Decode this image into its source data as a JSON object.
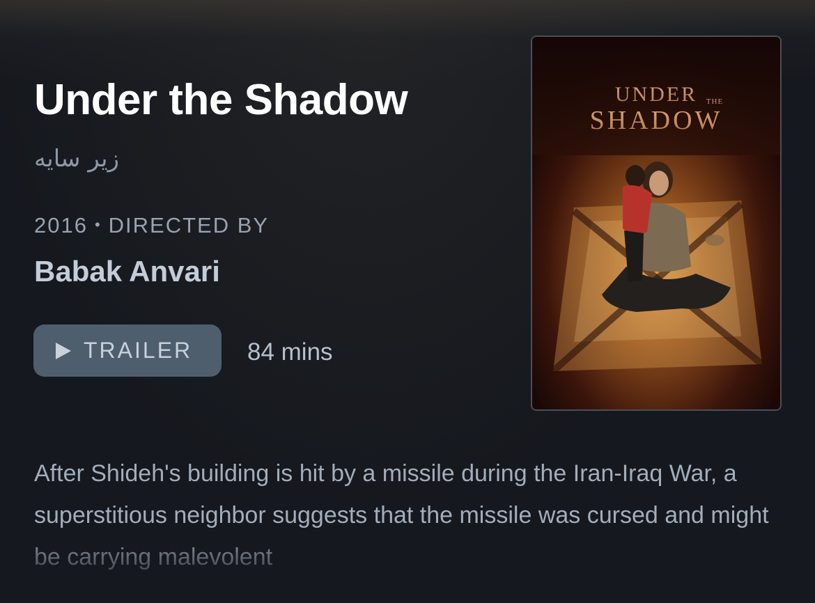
{
  "film": {
    "title": "Under the Shadow",
    "original_title": "زیر سایه",
    "year": "2016",
    "directed_by_label": "DIRECTED BY",
    "director": "Babak Anvari",
    "runtime": "84 mins",
    "synopsis": "After Shideh's building is hit by a missile during the Iran-Iraq War, a superstitious neighbor suggests that the missile was cursed and might be carrying malevolent"
  },
  "trailer_button": {
    "label": "TRAILER",
    "icon": "play-icon"
  },
  "poster": {
    "title_line1": "UNDER",
    "title_small": "THE",
    "title_line2": "SHADOW"
  },
  "colors": {
    "background": "#15181e",
    "button": "#4f5e6d",
    "title": "#ffffff",
    "muted_text": "#99a3b2"
  }
}
